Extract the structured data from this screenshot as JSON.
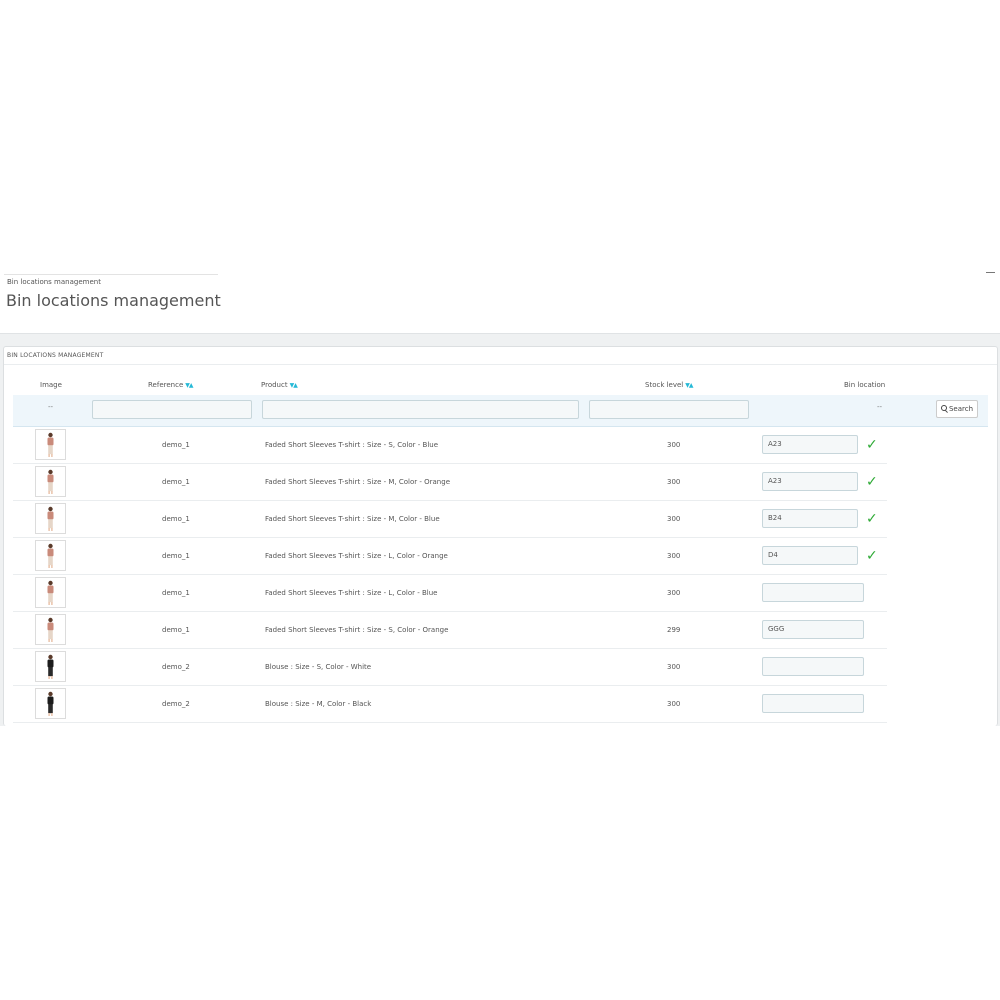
{
  "breadcrumb": "Bin locations management",
  "page_title": "Bin locations management",
  "panel_title": "BIN LOCATIONS MANAGEMENT",
  "columns": {
    "image": "Image",
    "reference": "Reference",
    "product": "Product",
    "stock_level": "Stock level",
    "bin_location": "Bin location"
  },
  "sort_icons": "▼▲",
  "filters": {
    "image_placeholder": "--",
    "bin_placeholder": "--",
    "search_label": "Search"
  },
  "rows": [
    {
      "image": "tshirt-woman-thumbnail",
      "reference": "demo_1",
      "product": "Faded Short Sleeves T-shirt : Size - S, Color - Blue",
      "stock": "300",
      "bin": "A23",
      "saved": "✓"
    },
    {
      "image": "tshirt-woman-thumbnail",
      "reference": "demo_1",
      "product": "Faded Short Sleeves T-shirt : Size - M, Color - Orange",
      "stock": "300",
      "bin": "A23",
      "saved": "✓"
    },
    {
      "image": "tshirt-woman-thumbnail",
      "reference": "demo_1",
      "product": "Faded Short Sleeves T-shirt : Size - M, Color - Blue",
      "stock": "300",
      "bin": "B24",
      "saved": "✓"
    },
    {
      "image": "tshirt-woman-thumbnail",
      "reference": "demo_1",
      "product": "Faded Short Sleeves T-shirt : Size - L, Color - Orange",
      "stock": "300",
      "bin": "D4",
      "saved": "✓"
    },
    {
      "image": "tshirt-woman-thumbnail",
      "reference": "demo_1",
      "product": "Faded Short Sleeves T-shirt : Size - L, Color - Blue",
      "stock": "300",
      "bin": "",
      "saved": ""
    },
    {
      "image": "tshirt-woman-thumbnail",
      "reference": "demo_1",
      "product": "Faded Short Sleeves T-shirt : Size - S, Color - Orange",
      "stock": "299",
      "bin": "GGG",
      "saved": ""
    },
    {
      "image": "blouse-woman-thumbnail",
      "reference": "demo_2",
      "product": "Blouse : Size - S, Color - White",
      "stock": "300",
      "bin": "",
      "saved": ""
    },
    {
      "image": "blouse-woman-thumbnail",
      "reference": "demo_2",
      "product": "Blouse : Size - M, Color - Black",
      "stock": "300",
      "bin": "",
      "saved": ""
    }
  ],
  "colors": {
    "accent": "#25b9d7",
    "check": "#2eaa36",
    "filter_row_bg": "#eef6fb",
    "content_bg": "#eff1f2"
  }
}
